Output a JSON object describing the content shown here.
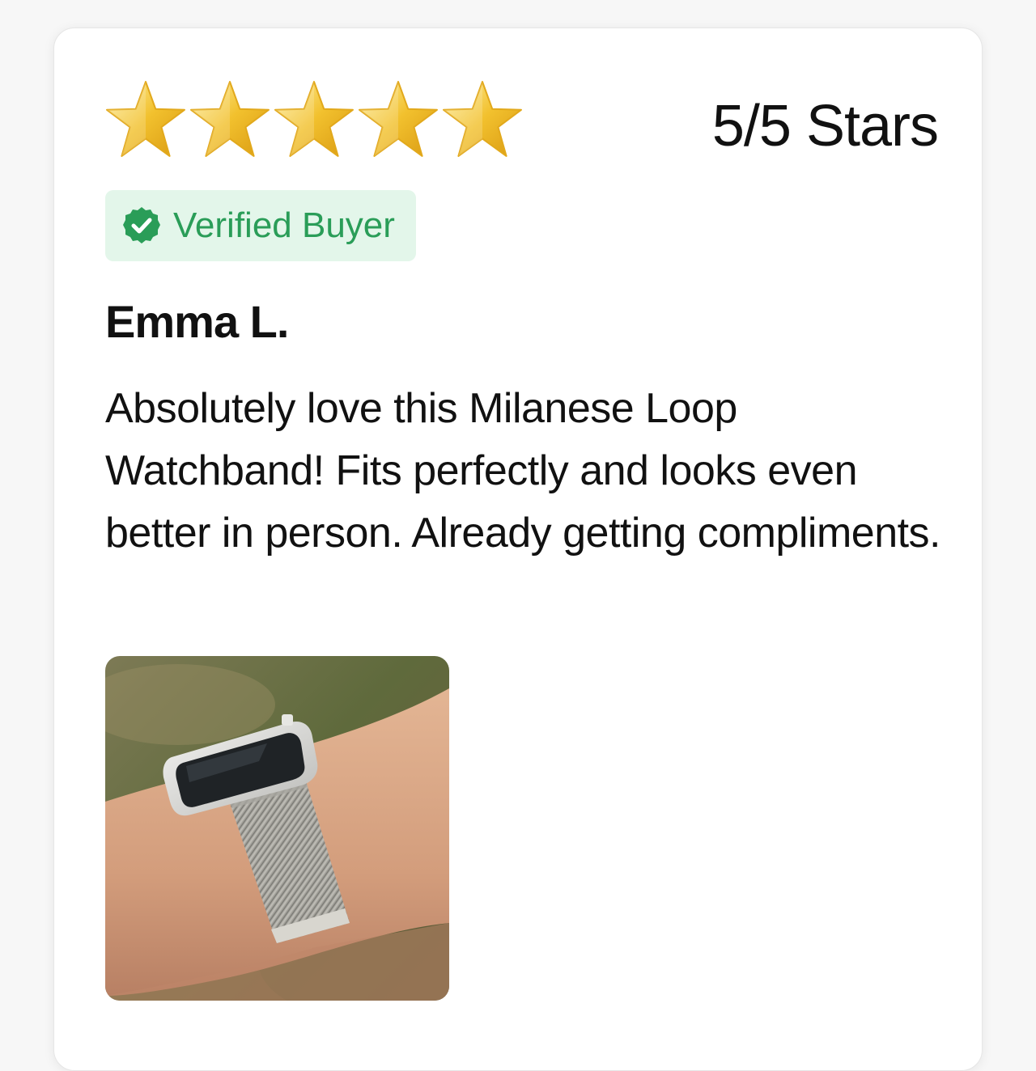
{
  "review": {
    "rating": 5,
    "rating_max": 5,
    "rating_text": "5/5 Stars",
    "badge": {
      "icon": "check-circle-icon",
      "label": "Verified Buyer",
      "color": "#2a9d58",
      "background": "#e3f6ea"
    },
    "reviewer_name": "Emma L.",
    "body": "Absolutely love this Milanese Loop Watchband! Fits perfectly and looks even better in person. Already getting compliments.",
    "star_color": "#f2c12e"
  }
}
